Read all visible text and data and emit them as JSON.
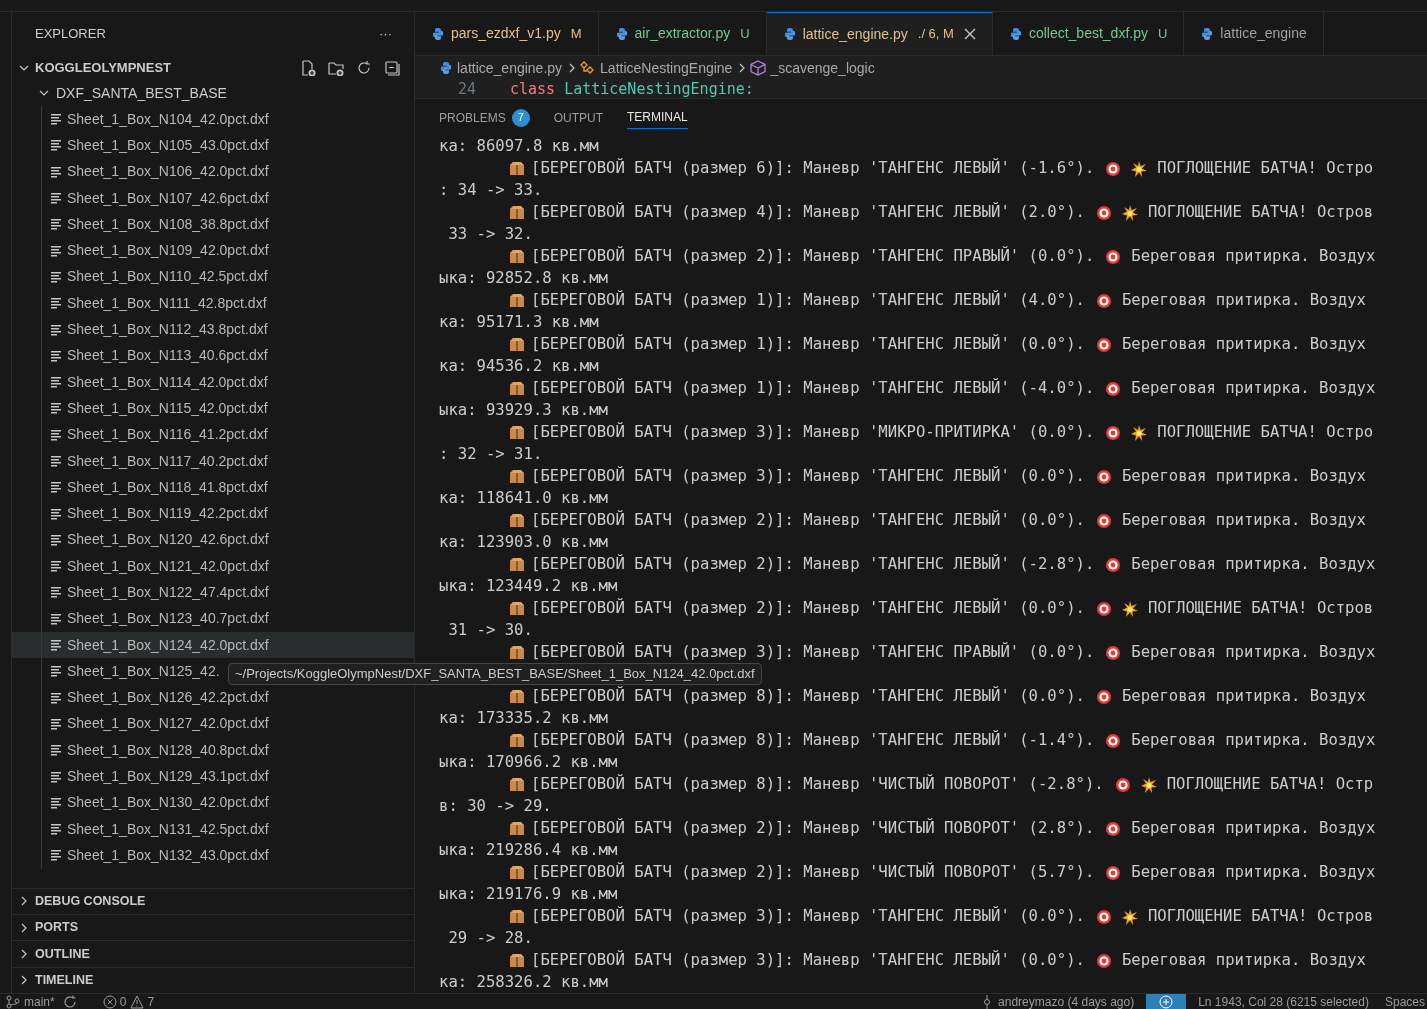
{
  "sidebar": {
    "title": "EXPLORER",
    "more": "···",
    "root": {
      "label": "KOGGLEOLYMPNEST",
      "expanded": true,
      "children": [
        {
          "label": "DXF_SANTA_BEST_BASE",
          "expanded": true,
          "children": [
            {
              "label": "Sheet_1_Box_N104_42.0pct.dxf",
              "selected": false
            },
            {
              "label": "Sheet_1_Box_N105_43.0pct.dxf",
              "selected": false
            },
            {
              "label": "Sheet_1_Box_N106_42.0pct.dxf",
              "selected": false
            },
            {
              "label": "Sheet_1_Box_N107_42.6pct.dxf",
              "selected": false
            },
            {
              "label": "Sheet_1_Box_N108_38.8pct.dxf",
              "selected": false
            },
            {
              "label": "Sheet_1_Box_N109_42.0pct.dxf",
              "selected": false
            },
            {
              "label": "Sheet_1_Box_N110_42.5pct.dxf",
              "selected": false
            },
            {
              "label": "Sheet_1_Box_N111_42.8pct.dxf",
              "selected": false
            },
            {
              "label": "Sheet_1_Box_N112_43.8pct.dxf",
              "selected": false
            },
            {
              "label": "Sheet_1_Box_N113_40.6pct.dxf",
              "selected": false
            },
            {
              "label": "Sheet_1_Box_N114_42.0pct.dxf",
              "selected": false
            },
            {
              "label": "Sheet_1_Box_N115_42.0pct.dxf",
              "selected": false
            },
            {
              "label": "Sheet_1_Box_N116_41.2pct.dxf",
              "selected": false
            },
            {
              "label": "Sheet_1_Box_N117_40.2pct.dxf",
              "selected": false
            },
            {
              "label": "Sheet_1_Box_N118_41.8pct.dxf",
              "selected": false
            },
            {
              "label": "Sheet_1_Box_N119_42.2pct.dxf",
              "selected": false
            },
            {
              "label": "Sheet_1_Box_N120_42.6pct.dxf",
              "selected": false
            },
            {
              "label": "Sheet_1_Box_N121_42.0pct.dxf",
              "selected": false
            },
            {
              "label": "Sheet_1_Box_N122_47.4pct.dxf",
              "selected": false
            },
            {
              "label": "Sheet_1_Box_N123_40.7pct.dxf",
              "selected": false
            },
            {
              "label": "Sheet_1_Box_N124_42.0pct.dxf",
              "selected": true
            },
            {
              "label": "Sheet_1_Box_N125_42.",
              "selected": false
            },
            {
              "label": "Sheet_1_Box_N126_42.2pct.dxf",
              "selected": false
            },
            {
              "label": "Sheet_1_Box_N127_42.0pct.dxf",
              "selected": false
            },
            {
              "label": "Sheet_1_Box_N128_40.8pct.dxf",
              "selected": false
            },
            {
              "label": "Sheet_1_Box_N129_43.1pct.dxf",
              "selected": false
            },
            {
              "label": "Sheet_1_Box_N130_42.0pct.dxf",
              "selected": false
            },
            {
              "label": "Sheet_1_Box_N131_42.5pct.dxf",
              "selected": false
            },
            {
              "label": "Sheet_1_Box_N132_43.0pct.dxf",
              "selected": false
            }
          ]
        }
      ]
    },
    "sections": [
      {
        "label": "DEBUG CONSOLE",
        "expanded": false
      },
      {
        "label": "PORTS",
        "expanded": false
      },
      {
        "label": "OUTLINE",
        "expanded": false
      },
      {
        "label": "TIMELINE",
        "expanded": false
      }
    ]
  },
  "tooltip": "~/Projects/KoggleOlympNest/DXF_SANTA_BEST_BASE/Sheet_1_Box_N124_42.0pct.dxf",
  "tabs": [
    {
      "label": "pars_ezdxf_v1.py",
      "badge": "M",
      "color": "#e2c08d",
      "selected": false
    },
    {
      "label": "air_extractor.py",
      "badge": "U",
      "color": "#73c991",
      "selected": false
    },
    {
      "label": "lattice_engine.py",
      "badge": "./ 6, M",
      "color": "#e2c08d",
      "selected": true
    },
    {
      "label": "collect_best_dxf.py",
      "badge": "U",
      "color": "#73c991",
      "selected": false
    },
    {
      "label": "lattice_engine",
      "color": "#a0a0a0",
      "selected": false
    }
  ],
  "breadcrumb": [
    {
      "kind": "file",
      "label": "lattice_engine.py"
    },
    {
      "kind": "class",
      "label": "LatticeNestingEngine"
    },
    {
      "kind": "method",
      "label": "_scavenge_logic"
    }
  ],
  "code_line": {
    "number": "24",
    "keyword": "class",
    "name": "LatticeNestingEngine:"
  },
  "panel_tabs": [
    {
      "label": "PROBLEMS",
      "count": "7",
      "selected": false
    },
    {
      "label": "OUTPUT",
      "selected": false
    },
    {
      "label": "TERMINAL",
      "selected": true
    }
  ],
  "terminal": [
    {
      "kind": "cont",
      "text": "ка: 86097.8 кв.мм"
    },
    {
      "kind": "batch",
      "text": "[БЕРЕГОВОЙ БАТЧ (размер 6)]: Маневр 'ТАНГЕНС ЛЕВЫЙ' (-1.6°).",
      "burst": true,
      "tail": "ПОГЛОЩЕНИЕ БАТЧА! Остро"
    },
    {
      "kind": "cont",
      "text": ": 34 -> 33."
    },
    {
      "kind": "batch",
      "text": "[БЕРЕГОВОЙ БАТЧ (размер 4)]: Маневр 'ТАНГЕНС ЛЕВЫЙ' (2.0°).",
      "burst": true,
      "tail": "ПОГЛОЩЕНИЕ БАТЧА! Остров"
    },
    {
      "kind": "cont",
      "text": " 33 -> 32."
    },
    {
      "kind": "batch",
      "text": "[БЕРЕГОВОЙ БАТЧ (размер 2)]: Маневр 'ТАНГЕНС ПРАВЫЙ' (0.0°).",
      "burst": false,
      "tail": "Береговая притирка. Воздух"
    },
    {
      "kind": "cont",
      "text": "ыка: 92852.8 кв.мм"
    },
    {
      "kind": "batch",
      "text": "[БЕРЕГОВОЙ БАТЧ (размер 1)]: Маневр 'ТАНГЕНС ЛЕВЫЙ' (4.0°).",
      "burst": false,
      "tail": "Береговая притирка. Воздух"
    },
    {
      "kind": "cont",
      "text": "ка: 95171.3 кв.мм"
    },
    {
      "kind": "batch",
      "text": "[БЕРЕГОВОЙ БАТЧ (размер 1)]: Маневр 'ТАНГЕНС ЛЕВЫЙ' (0.0°).",
      "burst": false,
      "tail": "Береговая притирка. Воздух"
    },
    {
      "kind": "cont",
      "text": "ка: 94536.2 кв.мм"
    },
    {
      "kind": "batch",
      "text": "[БЕРЕГОВОЙ БАТЧ (размер 1)]: Маневр 'ТАНГЕНС ЛЕВЫЙ' (-4.0°).",
      "burst": false,
      "tail": "Береговая притирка. Воздух"
    },
    {
      "kind": "cont",
      "text": "ыка: 93929.3 кв.мм"
    },
    {
      "kind": "batch",
      "text": "[БЕРЕГОВОЙ БАТЧ (размер 3)]: Маневр 'МИКРО-ПРИТИРКА' (0.0°).",
      "burst": true,
      "tail": "ПОГЛОЩЕНИЕ БАТЧА! Остро"
    },
    {
      "kind": "cont",
      "text": ": 32 -> 31."
    },
    {
      "kind": "batch",
      "text": "[БЕРЕГОВОЙ БАТЧ (размер 3)]: Маневр 'ТАНГЕНС ЛЕВЫЙ' (0.0°).",
      "burst": false,
      "tail": "Береговая притирка. Воздух"
    },
    {
      "kind": "cont",
      "text": "ка: 118641.0 кв.мм"
    },
    {
      "kind": "batch",
      "text": "[БЕРЕГОВОЙ БАТЧ (размер 2)]: Маневр 'ТАНГЕНС ЛЕВЫЙ' (0.0°).",
      "burst": false,
      "tail": "Береговая притирка. Воздух"
    },
    {
      "kind": "cont",
      "text": "ка: 123903.0 кв.мм"
    },
    {
      "kind": "batch",
      "text": "[БЕРЕГОВОЙ БАТЧ (размер 2)]: Маневр 'ТАНГЕНС ЛЕВЫЙ' (-2.8°).",
      "burst": false,
      "tail": "Береговая притирка. Воздух"
    },
    {
      "kind": "cont",
      "text": "ыка: 123449.2 кв.мм"
    },
    {
      "kind": "batch",
      "text": "[БЕРЕГОВОЙ БАТЧ (размер 2)]: Маневр 'ТАНГЕНС ЛЕВЫЙ' (0.0°).",
      "burst": true,
      "tail": "ПОГЛОЩЕНИЕ БАТЧА! Остров"
    },
    {
      "kind": "cont",
      "text": " 31 -> 30."
    },
    {
      "kind": "batch",
      "text": "[БЕРЕГОВОЙ БАТЧ (размер 3)]: Маневр 'ТАНГЕНС ПРАВЫЙ' (0.0°).",
      "burst": false,
      "tail": "Береговая притирка. Воздух"
    },
    {
      "kind": "covered"
    },
    {
      "kind": "batch",
      "text": "[БЕРЕГОВОЙ БАТЧ (размер 8)]: Маневр 'ТАНГЕНС ЛЕВЫЙ' (0.0°).",
      "burst": false,
      "tail": "Береговая притирка. Воздух"
    },
    {
      "kind": "cont",
      "text": "ка: 173335.2 кв.мм"
    },
    {
      "kind": "batch",
      "text": "[БЕРЕГОВОЙ БАТЧ (размер 8)]: Маневр 'ТАНГЕНС ЛЕВЫЙ' (-1.4°).",
      "burst": false,
      "tail": "Береговая притирка. Воздух"
    },
    {
      "kind": "cont",
      "text": "ыка: 170966.2 кв.мм"
    },
    {
      "kind": "batch",
      "text": "[БЕРЕГОВОЙ БАТЧ (размер 8)]: Маневр 'ЧИСТЫЙ ПОВОРОТ' (-2.8°).",
      "burst": true,
      "tail": "ПОГЛОЩЕНИЕ БАТЧА! Остр"
    },
    {
      "kind": "cont",
      "text": "в: 30 -> 29."
    },
    {
      "kind": "batch",
      "text": "[БЕРЕГОВОЙ БАТЧ (размер 2)]: Маневр 'ЧИСТЫЙ ПОВОРОТ' (2.8°).",
      "burst": false,
      "tail": "Береговая притирка. Воздух"
    },
    {
      "kind": "cont",
      "text": "ыка: 219286.4 кв.мм"
    },
    {
      "kind": "batch",
      "text": "[БЕРЕГОВОЙ БАТЧ (размер 2)]: Маневр 'ЧИСТЫЙ ПОВОРОТ' (5.7°).",
      "burst": false,
      "tail": "Береговая притирка. Воздух"
    },
    {
      "kind": "cont",
      "text": "ыка: 219176.9 кв.мм"
    },
    {
      "kind": "batch",
      "text": "[БЕРЕГОВОЙ БАТЧ (размер 3)]: Маневр 'ТАНГЕНС ЛЕВЫЙ' (0.0°).",
      "burst": true,
      "tail": "ПОГЛОЩЕНИЕ БАТЧА! Остров"
    },
    {
      "kind": "cont",
      "text": " 29 -> 28."
    },
    {
      "kind": "batch",
      "text": "[БЕРЕГОВОЙ БАТЧ (размер 3)]: Маневр 'ТАНГЕНС ЛЕВЫЙ' (0.0°).",
      "burst": false,
      "tail": "Береговая притирка. Воздух"
    },
    {
      "kind": "cont",
      "text": "ка: 258326.2 кв.мм"
    }
  ],
  "status_bar": {
    "branch": "main*",
    "errors": "0",
    "warnings": "7",
    "blame": "andreymazo (4 days ago)",
    "cursor": "Ln 1943, Col 28 (6215 selected)",
    "indent": "Spaces"
  }
}
